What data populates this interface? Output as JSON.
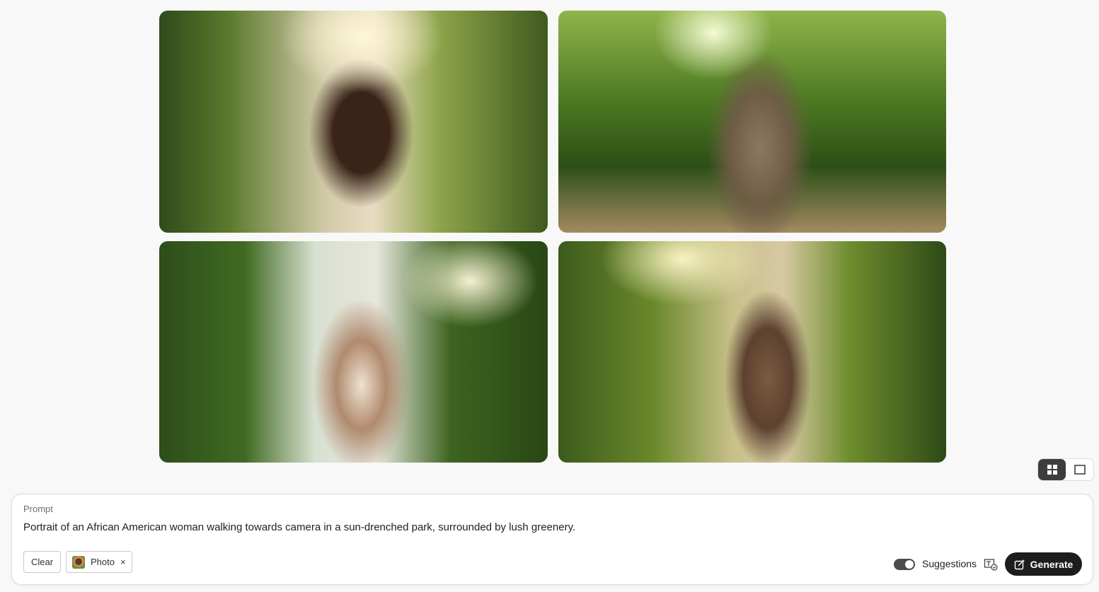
{
  "gallery": {
    "images": [
      {
        "alt_icon": "photo-woman-sunset-path"
      },
      {
        "alt_icon": "photo-woman-forest-path"
      },
      {
        "alt_icon": "photo-woman-hedge-walkway"
      },
      {
        "alt_icon": "photo-woman-green-corridor"
      }
    ]
  },
  "view_toggle": {
    "grid_icon": "grid-icon",
    "single_icon": "single-view-icon",
    "active": "grid"
  },
  "prompt": {
    "label": "Prompt",
    "text": "Portrait of an African American woman walking towards camera in a sun-drenched park, surrounded by lush greenery.",
    "clear_label": "Clear",
    "chip_label": "Photo",
    "chip_close": "×",
    "suggestions_label": "Suggestions",
    "suggestions_on": true,
    "generate_label": "Generate"
  },
  "colors": {
    "background": "#f8f8f8",
    "generate_bg": "#1d1d1d",
    "toggle_on": "#4b4b4b"
  }
}
